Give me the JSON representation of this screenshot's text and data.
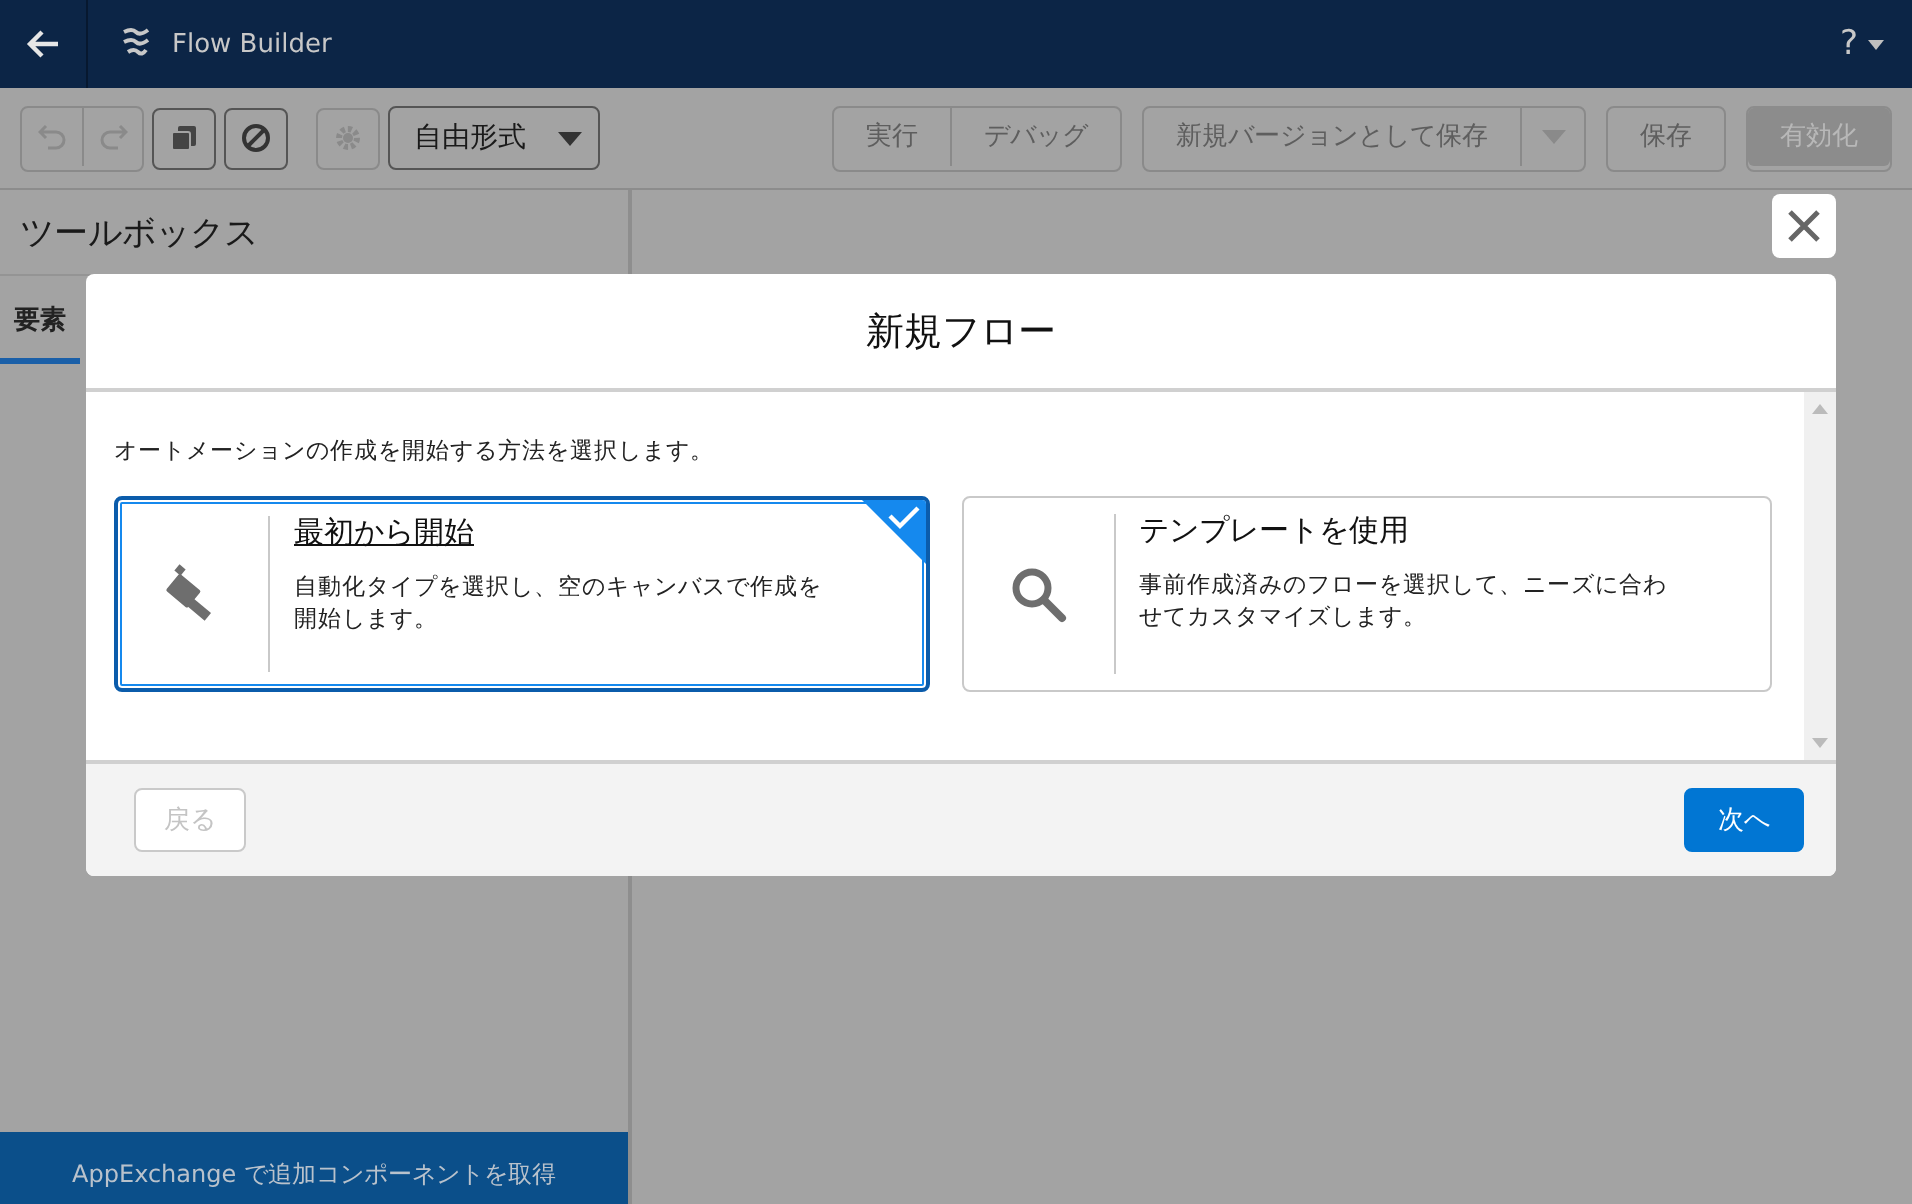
{
  "header": {
    "title": "Flow Builder",
    "help": "?"
  },
  "toolbar": {
    "mode": "自由形式",
    "action_groups": [
      [
        {
          "label": "実行",
          "kind": "neutral",
          "disabled": true
        },
        {
          "label": "デバッグ",
          "kind": "neutral",
          "disabled": true
        }
      ],
      [
        {
          "label": "新規バージョンとして保存",
          "kind": "neutral",
          "disabled": true
        },
        {
          "kind": "menu",
          "disabled": true
        }
      ],
      [
        {
          "label": "保存",
          "kind": "neutral",
          "disabled": true
        }
      ],
      [
        {
          "label": "有効化",
          "kind": "brand",
          "disabled": true
        }
      ]
    ]
  },
  "toolbox": {
    "title": "ツールボックス",
    "tabs": [
      {
        "label": "要素",
        "selected": true
      }
    ],
    "footer_link": "AppExchange で追加コンポーネントを取得"
  },
  "modal": {
    "title": "新規フロー",
    "intro": "オートメーションの作成を開始する方法を選択します。",
    "options": [
      {
        "kind": "hammer",
        "title": "最初から開始",
        "description": "自動化タイプを選択し、空のキャンバスで作成を開始します。",
        "selected": true
      },
      {
        "kind": "search",
        "title": "テンプレートを使用",
        "description": "事前作成済みのフローを選択して、ニーズに合わせてカスタマイズします。",
        "selected": false
      }
    ],
    "back": {
      "label": "戻る",
      "disabled": true
    },
    "next": {
      "label": "次へ",
      "disabled": false
    }
  }
}
